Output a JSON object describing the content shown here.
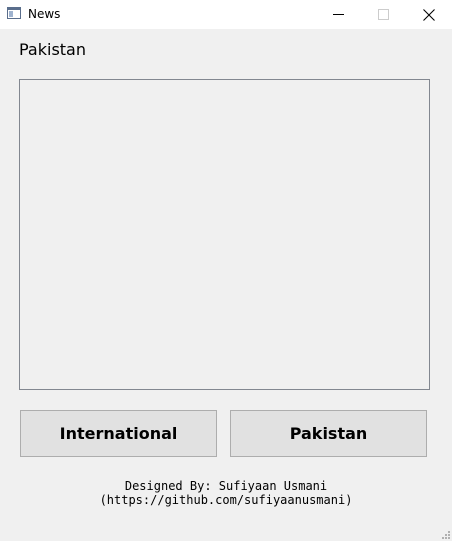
{
  "window": {
    "title": "News",
    "icon": "app-window-icon",
    "controls": {
      "minimize_icon": "minimize-icon",
      "maximize_icon": "maximize-icon",
      "close_icon": "close-icon"
    }
  },
  "main": {
    "section_label": "Pakistan",
    "content_text": ""
  },
  "buttons": {
    "international_label": "International",
    "pakistan_label": "Pakistan"
  },
  "footer": {
    "credit": "Designed By: Sufiyaan Usmani (https://github.com/sufiyaanusmani)"
  },
  "colors": {
    "window_bg": "#f0f0f0",
    "titlebar_bg": "#ffffff",
    "button_bg": "#e1e1e1",
    "button_border": "#adadad",
    "box_border": "#828790"
  }
}
